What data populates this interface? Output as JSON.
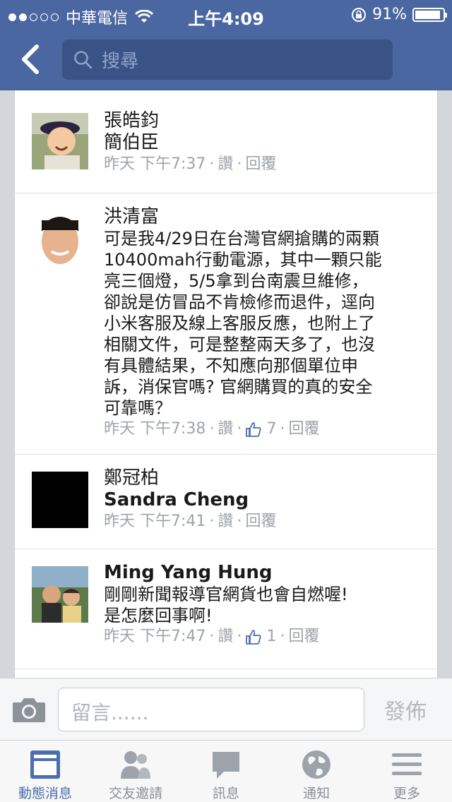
{
  "status_bar": {
    "carrier": "中華電信",
    "time": "上午4:09",
    "battery": "91%",
    "battery_level": 0.91
  },
  "nav": {
    "search_placeholder": "搜尋"
  },
  "comments": [
    {
      "name": "張皓鈞",
      "text": "簡伯臣",
      "day": "昨天",
      "time": "下午7:37",
      "like": "讚",
      "reply": "回覆",
      "like_count": ""
    },
    {
      "name": "洪清富",
      "text_lines": [
        "可是我4/29日在台灣官網搶購的兩顆",
        "10400mah行動電源，其中一顆只能",
        "亮三個燈，5/5拿到台南震旦維修，",
        "卻說是仿冒品不肯檢修而退件，逕向",
        "小米客服及線上客服反應，也附上了",
        "相關文件，可是整整兩天多了，也沒",
        "有具體結果，不知應向那個單位申",
        "訴，消保官嗎? 官網購買的真的安全",
        "可靠嗎？"
      ],
      "day": "昨天",
      "time": "下午7:38",
      "like": "讚",
      "reply": "回覆",
      "like_count": "7"
    },
    {
      "name": "鄭冠柏",
      "text": "Sandra Cheng",
      "day": "昨天",
      "time": "下午7:41",
      "like": "讚",
      "reply": "回覆",
      "like_count": ""
    },
    {
      "name": "Ming Yang Hung",
      "text_lines": [
        "剛剛新聞報導官網貨也會自燃喔!",
        "是怎麼回事啊!"
      ],
      "day": "昨天",
      "time": "下午7:47",
      "like": "讚",
      "reply": "回覆",
      "like_count": "1"
    }
  ],
  "compose": {
    "placeholder": "留言......",
    "post_label": "發佈"
  },
  "tabs": [
    {
      "label": "動態消息",
      "icon": "news-feed-icon",
      "active": true
    },
    {
      "label": "交友邀請",
      "icon": "friends-icon",
      "active": false
    },
    {
      "label": "訊息",
      "icon": "messages-icon",
      "active": false
    },
    {
      "label": "通知",
      "icon": "globe-icon",
      "active": false
    },
    {
      "label": "更多",
      "icon": "menu-icon",
      "active": false
    }
  ],
  "colors": {
    "header": "#4b67a1",
    "accent": "#4b6ead",
    "meta_text": "#9ea3ab"
  }
}
